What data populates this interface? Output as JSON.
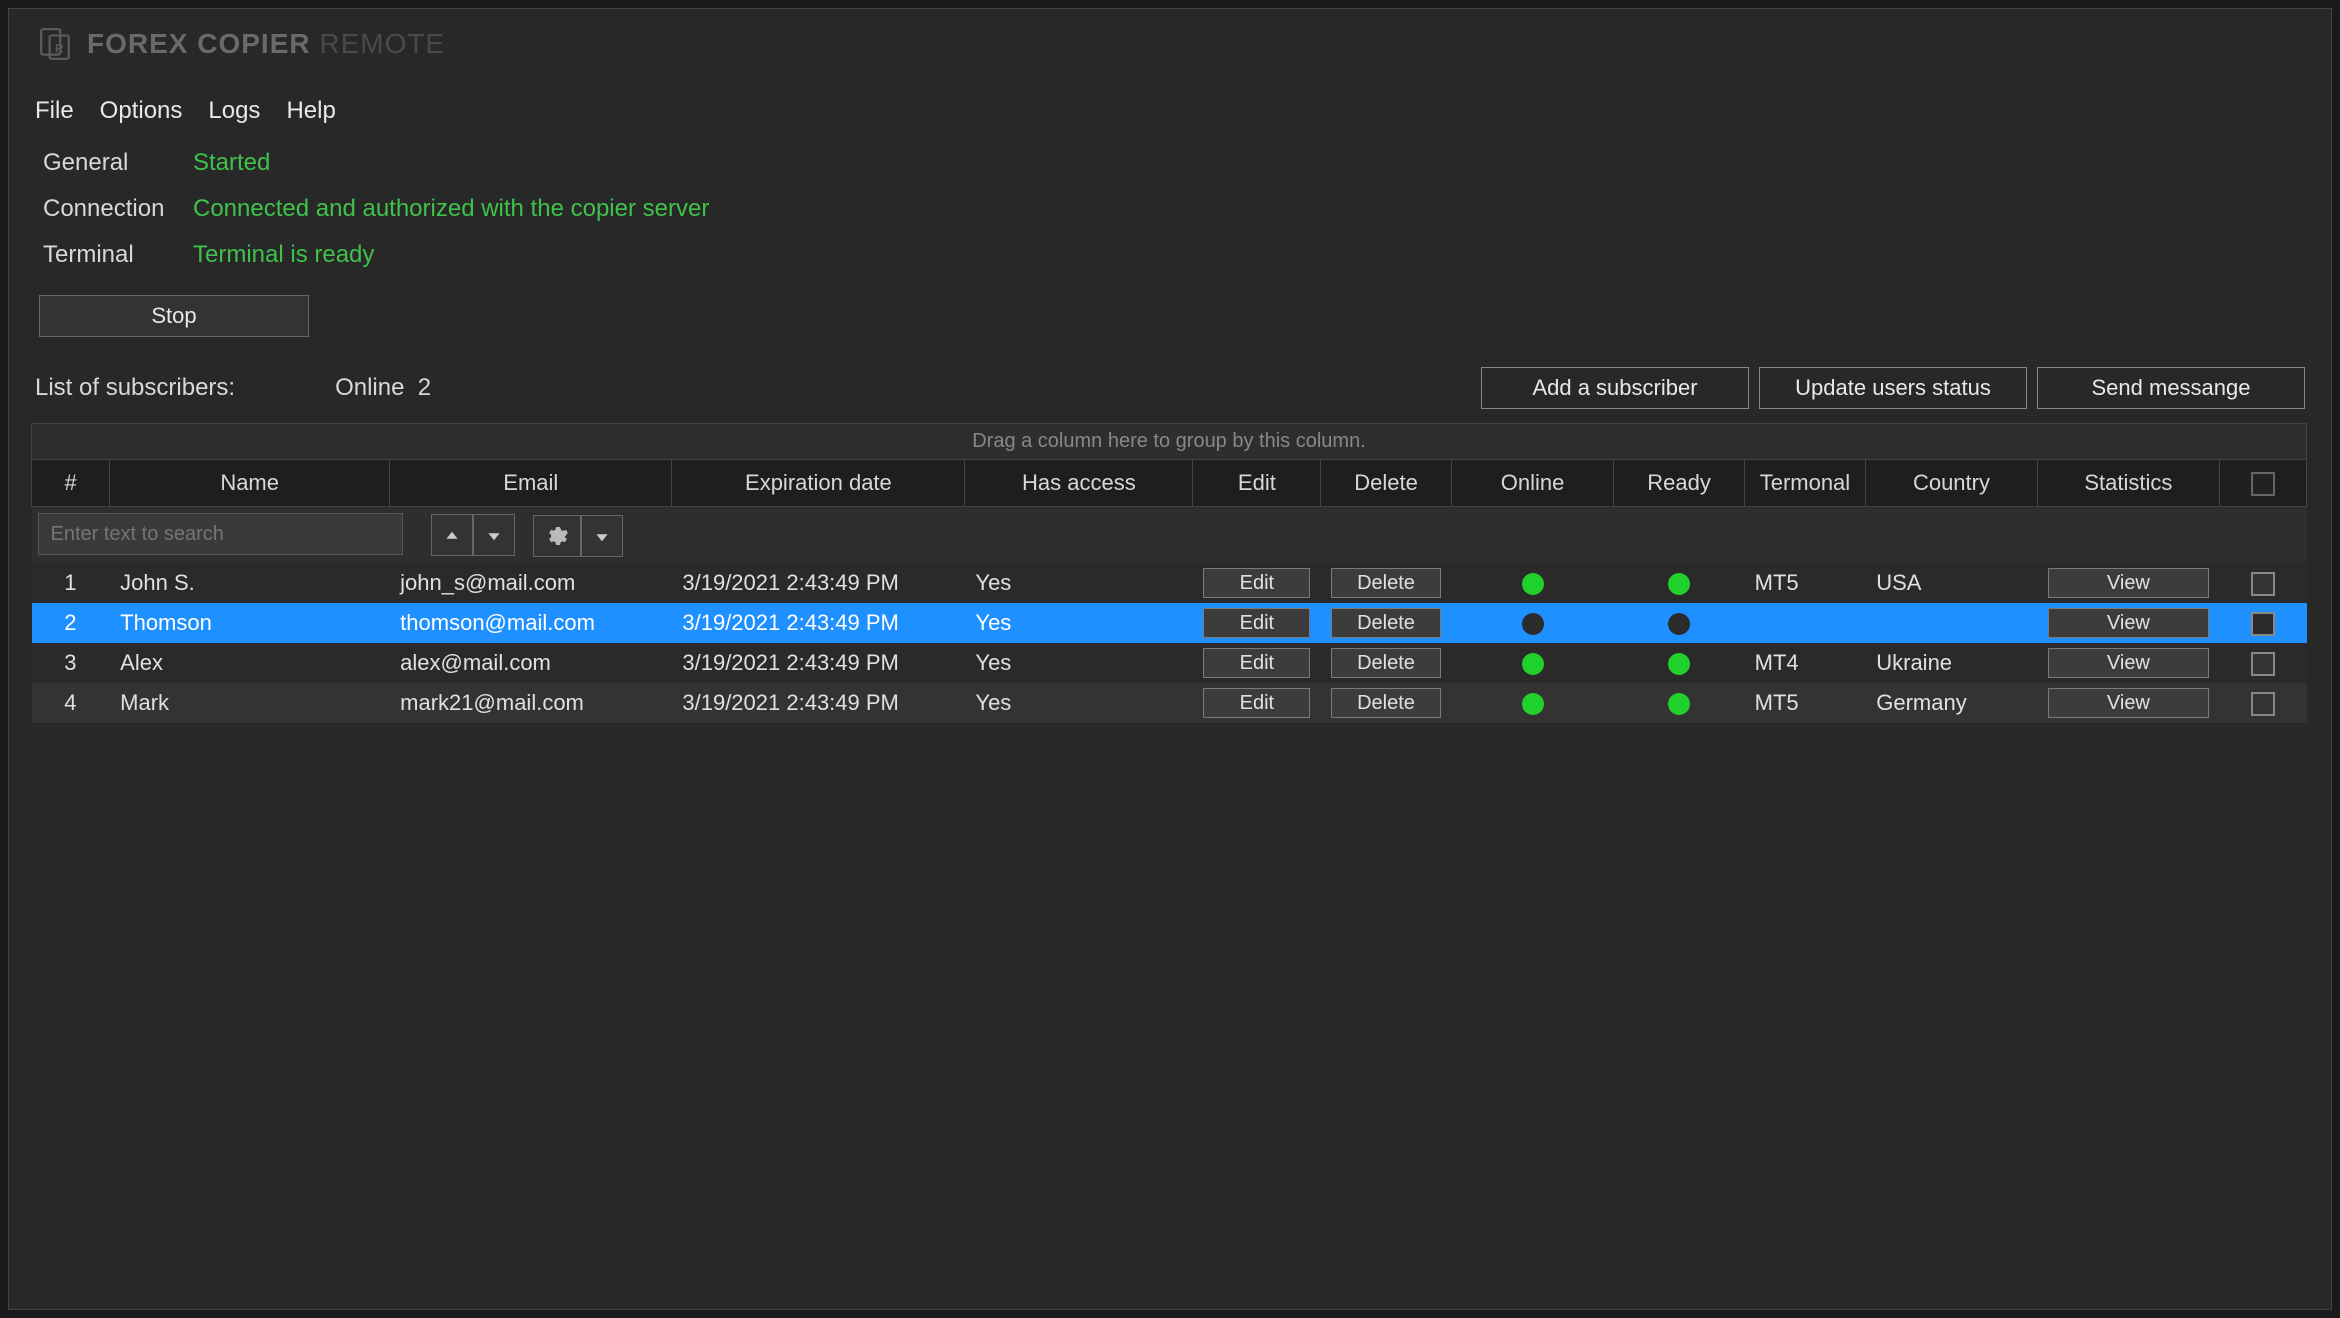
{
  "app": {
    "title_bold": "FOREX COPIER",
    "title_light": "REMOTE"
  },
  "menu": {
    "file": "File",
    "options": "Options",
    "logs": "Logs",
    "help": "Help"
  },
  "status": {
    "general_label": "General",
    "general_value": "Started",
    "connection_label": "Connection",
    "connection_value": "Connected and authorized with the copier server",
    "terminal_label": "Terminal",
    "terminal_value": "Terminal is ready"
  },
  "stop_label": "Stop",
  "subs": {
    "list_label": "List of subscribers:",
    "online_label": "Online",
    "online_count": "2",
    "add_btn": "Add a subscriber",
    "update_btn": "Update users status",
    "send_btn": "Send messange"
  },
  "grid": {
    "group_hint": "Drag a column here to group by this column.",
    "headers": {
      "idx": "#",
      "name": "Name",
      "email": "Email",
      "exp": "Expiration date",
      "access": "Has access",
      "edit": "Edit",
      "delete": "Delete",
      "online": "Online",
      "ready": "Ready",
      "terminal": "Termonal",
      "country": "Country",
      "stats": "Statistics"
    },
    "search_placeholder": "Enter text to search",
    "edit_label": "Edit",
    "delete_label": "Delete",
    "view_label": "View",
    "rows": [
      {
        "idx": "1",
        "name": "John S.",
        "email": "john_s@mail.com",
        "exp": "3/19/2021 2:43:49 PM",
        "access": "Yes",
        "online": true,
        "ready": true,
        "terminal": "MT5",
        "country": "USA",
        "selected": false
      },
      {
        "idx": "2",
        "name": "Thomson",
        "email": "thomson@mail.com",
        "exp": "3/19/2021 2:43:49 PM",
        "access": "Yes",
        "online": false,
        "ready": false,
        "terminal": "",
        "country": "",
        "selected": true
      },
      {
        "idx": "3",
        "name": "Alex",
        "email": "alex@mail.com",
        "exp": "3/19/2021 2:43:49 PM",
        "access": "Yes",
        "online": true,
        "ready": true,
        "terminal": "MT4",
        "country": "Ukraine",
        "selected": false
      },
      {
        "idx": "4",
        "name": "Mark",
        "email": "mark21@mail.com",
        "exp": "3/19/2021 2:43:49 PM",
        "access": "Yes",
        "online": true,
        "ready": true,
        "terminal": "MT5",
        "country": "Germany",
        "selected": false
      }
    ]
  }
}
